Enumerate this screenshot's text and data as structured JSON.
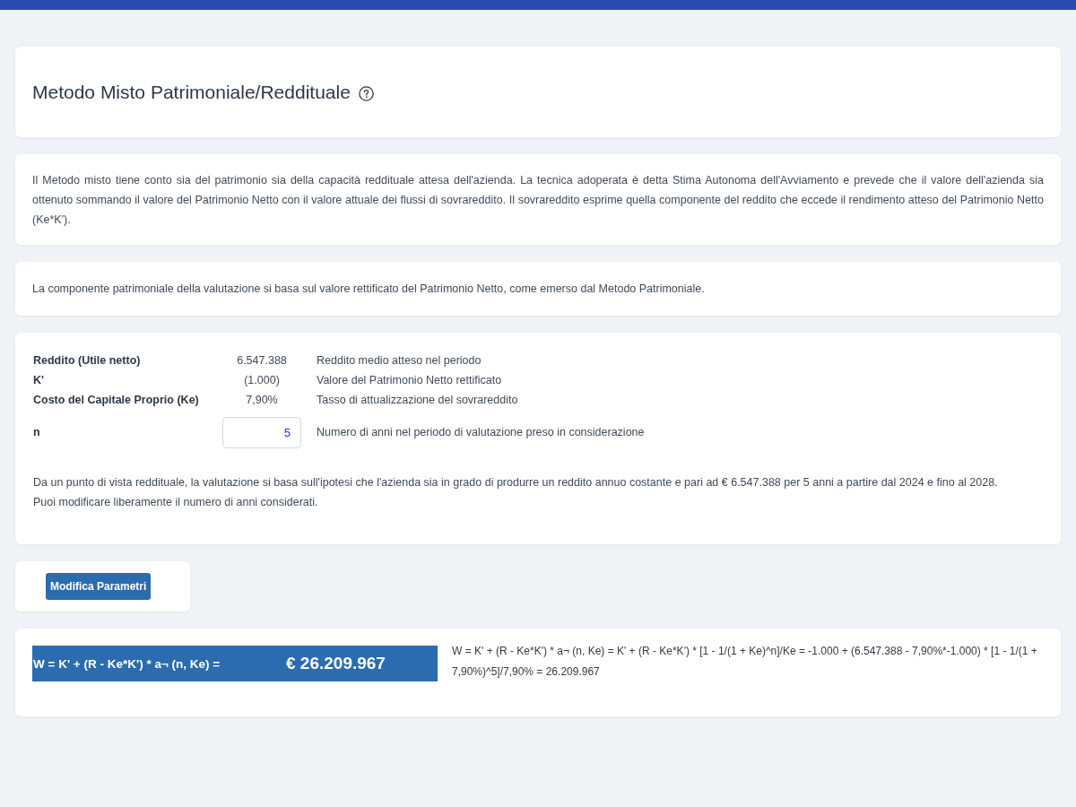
{
  "header": {
    "title": "Metodo Misto Patrimoniale/Reddituale"
  },
  "intro": {
    "text": "Il Metodo misto tiene conto sia del patrimonio sia della capacità reddituale attesa dell'azienda. La tecnica adoperata è detta Stima Autonoma dell'Avviamento e prevede che il valore dell'azienda sia ottenuto sommando il valore del Patrimonio Netto con il valore attuale dei flussi di sovrareddito. Il sovrareddito esprime quella componente del reddito che eccede il rendimento atteso del Patrimonio Netto (Ke*K')."
  },
  "note": {
    "text": "La componente patrimoniale della valutazione si basa sul valore rettificato del Patrimonio Netto, come emerso dal Metodo Patrimoniale."
  },
  "parameters": {
    "rows": [
      {
        "kind": "value",
        "label": "Reddito (Utile netto)",
        "value": "6.547.388",
        "description": "Reddito medio atteso nel periodo"
      },
      {
        "kind": "value",
        "label": "K'",
        "value": "(1.000)",
        "description": "Valore del Patrimonio Netto rettificato"
      },
      {
        "kind": "value",
        "label": "Costo del Capitale Proprio (Ke)",
        "value": "7,90%",
        "description": "Tasso di attualizzazione del sovrareddito"
      },
      {
        "kind": "input",
        "label": "n",
        "value": "5",
        "description": "Numero di anni nel periodo di valutazione preso in considerazione"
      }
    ],
    "summary": [
      "Da un punto di vista reddituale, la valutazione si basa sull'ipotesi che l'azienda sia in grado di produrre un reddito annuo costante e pari ad € 6.547.388 per 5 anni a partire dal 2024 e fino al 2028.",
      "Puoi modificare liberamente il numero di anni considerati."
    ]
  },
  "actions": {
    "button": "Modifica Parametri"
  },
  "result": {
    "label": "W = K' + (R - Ke*K') * a¬ (n, Ke) =",
    "value": "€ 26.209.967",
    "formula": "W = K' + (R - Ke*K') * a¬ (n, Ke) = K' + (R - Ke*K') * [1 - 1/(1 + Ke)^n]/Ke = -1.000 + (6.547.388 - 7,90%*-1.000) * [1 - 1/(1 + 7,90%)^5]/7,90% = 26.209.967"
  }
}
